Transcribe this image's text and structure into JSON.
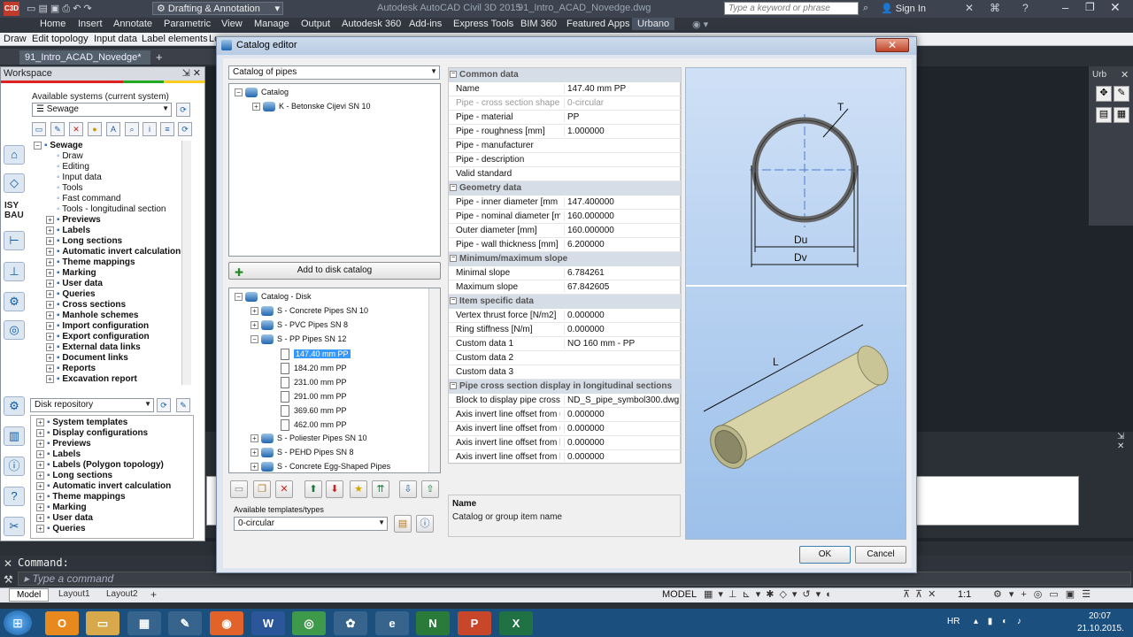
{
  "titlebar": {
    "workspace": "Drafting & Annotation",
    "app_title": "Autodesk AutoCAD Civil 3D 2015",
    "file": "91_Intro_ACAD_Novedge.dwg",
    "search_placeholder": "Type a keyword or phrase",
    "sign_in": "Sign In"
  },
  "ribbon_tabs": [
    "Home",
    "Insert",
    "Annotate",
    "Parametric",
    "View",
    "Manage",
    "Output",
    "Autodesk 360",
    "Add-ins",
    "Express Tools",
    "BIM 360",
    "Featured Apps",
    "Urbano"
  ],
  "menubar": [
    "Draw",
    "Edit topology",
    "Input data",
    "Label elements",
    "Lo"
  ],
  "doc_tab": "91_Intro_ACAD_Novedge*",
  "workspace": {
    "title": "Workspace",
    "available_systems_label": "Available systems (current system)",
    "system_value": "Sewage",
    "tree": [
      {
        "label": "Sewage",
        "level": 0,
        "bold": true
      },
      {
        "label": "Draw",
        "level": 1,
        "bold": false
      },
      {
        "label": "Editing",
        "level": 1,
        "bold": false
      },
      {
        "label": "Input data",
        "level": 1,
        "bold": false
      },
      {
        "label": "Tools",
        "level": 1,
        "bold": false
      },
      {
        "label": "Fast command",
        "level": 1,
        "bold": false
      },
      {
        "label": "Tools - longitudinal section",
        "level": 1,
        "bold": false
      },
      {
        "label": "Previews",
        "level": 1,
        "bold": true
      },
      {
        "label": "Labels",
        "level": 1,
        "bold": true
      },
      {
        "label": "Long sections",
        "level": 1,
        "bold": true
      },
      {
        "label": "Automatic invert calculation",
        "level": 1,
        "bold": true
      },
      {
        "label": "Theme mappings",
        "level": 1,
        "bold": true
      },
      {
        "label": "Marking",
        "level": 1,
        "bold": true
      },
      {
        "label": "User data",
        "level": 1,
        "bold": true
      },
      {
        "label": "Queries",
        "level": 1,
        "bold": true
      },
      {
        "label": "Cross sections",
        "level": 1,
        "bold": true
      },
      {
        "label": "Manhole schemes",
        "level": 1,
        "bold": true
      },
      {
        "label": "Import configuration",
        "level": 1,
        "bold": true
      },
      {
        "label": "Export configuration",
        "level": 1,
        "bold": true
      },
      {
        "label": "External data links",
        "level": 1,
        "bold": true
      },
      {
        "label": "Document links",
        "level": 1,
        "bold": true
      },
      {
        "label": "Reports",
        "level": 1,
        "bold": true
      },
      {
        "label": "Excavation report",
        "level": 1,
        "bold": true
      }
    ],
    "repository_value": "Disk repository",
    "repo_tree": [
      "System templates",
      "Display configurations",
      "Previews",
      "Labels",
      "Labels (Polygon topology)",
      "Long sections",
      "Automatic invert calculation",
      "Theme mappings",
      "Marking",
      "User data",
      "Queries"
    ]
  },
  "side_labels": {
    "isy": "ISY",
    "bau": "BAU"
  },
  "dialog": {
    "title": "Catalog editor",
    "catalog_combo": "Catalog of pipes",
    "top_tree": {
      "root": "Catalog",
      "child": "K - Betonske Cijevi SN 10"
    },
    "add_button": "Add to disk catalog",
    "disk_tree": {
      "root": "Catalog - Disk",
      "groups_before": [
        "S - Concrete Pipes SN 10",
        "S - PVC Pipes SN 8",
        "S - PP Pipes SN 12"
      ],
      "items": [
        "147.40 mm PP",
        "184.20 mm PP",
        "231.00 mm PP",
        "291.00 mm PP",
        "369.60 mm PP",
        "462.00 mm PP"
      ],
      "groups_after": [
        "S - Poliester Pipes SN 10",
        "S - PEHD Pipes SN 8",
        "S - Concrete Egg-Shaped Pipes"
      ]
    },
    "templates_label": "Available templates/types",
    "templates_value": "0-circular",
    "props": [
      {
        "cat": "Common data",
        "rows": [
          {
            "k": "Name",
            "v": "147.40 mm PP",
            "dim": false
          },
          {
            "k": "Pipe - cross section shape",
            "v": "0-circular",
            "dim": true
          },
          {
            "k": "Pipe - material",
            "v": "PP",
            "dim": false
          },
          {
            "k": "Pipe - roughness [mm]",
            "v": "1.000000",
            "dim": false
          },
          {
            "k": "Pipe - manufacturer",
            "v": "",
            "dim": false
          },
          {
            "k": "Pipe - description",
            "v": "",
            "dim": false
          },
          {
            "k": "Valid standard",
            "v": "",
            "dim": false
          }
        ]
      },
      {
        "cat": "Geometry data",
        "rows": [
          {
            "k": "Pipe - inner diameter [mm",
            "v": "147.400000",
            "dim": false
          },
          {
            "k": "Pipe - nominal diameter [m",
            "v": "160.000000",
            "dim": false
          },
          {
            "k": "Outer diameter [mm]",
            "v": "160.000000",
            "dim": false
          },
          {
            "k": "Pipe - wall thickness [mm]",
            "v": "6.200000",
            "dim": false
          }
        ]
      },
      {
        "cat": "Minimum/maximum slope",
        "rows": [
          {
            "k": "Minimal slope",
            "v": "6.784261",
            "dim": false
          },
          {
            "k": "Maximum slope",
            "v": "67.842605",
            "dim": false
          }
        ]
      },
      {
        "cat": "Item specific data",
        "rows": [
          {
            "k": "Vertex thrust force [N/m2]",
            "v": "0.000000",
            "dim": false
          },
          {
            "k": "Ring stiffness [N/m]",
            "v": "0.000000",
            "dim": false
          },
          {
            "k": "Custom data 1",
            "v": "NO 160 mm - PP",
            "dim": false
          },
          {
            "k": "Custom data 2",
            "v": "",
            "dim": false
          },
          {
            "k": "Custom data 3",
            "v": "",
            "dim": false
          }
        ]
      },
      {
        "cat": "Pipe cross section display in longitudinal sections",
        "rows": [
          {
            "k": "Block to display pipe cross",
            "v": "ND_S_pipe_symbol300.dwg",
            "dim": false
          },
          {
            "k": "Axis invert line offset from u",
            "v": "0.000000",
            "dim": false
          },
          {
            "k": "Axis invert line offset from u",
            "v": "0.000000",
            "dim": false
          },
          {
            "k": "Axis invert line offset from l",
            "v": "0.000000",
            "dim": false
          },
          {
            "k": "Axis invert line offset from l",
            "v": "0.000000",
            "dim": false
          }
        ]
      }
    ],
    "desc_title": "Name",
    "desc_text": "Catalog or group item name",
    "preview_labels": {
      "t": "T",
      "du": "Du",
      "dv": "Dv",
      "l": "L"
    },
    "ok": "OK",
    "cancel": "Cancel"
  },
  "command": {
    "label": "Command:",
    "placeholder": "Type a command"
  },
  "status": {
    "tabs": [
      "Model",
      "Layout1",
      "Layout2"
    ],
    "model": "MODEL",
    "scale": "1:1",
    "lang": "HR",
    "time": "20:07",
    "date": "21.10.2015."
  }
}
